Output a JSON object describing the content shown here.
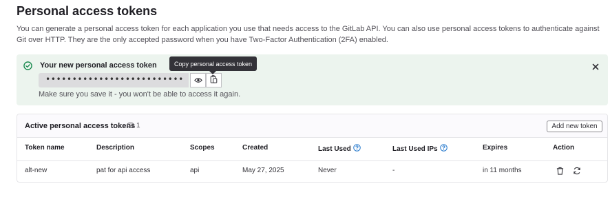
{
  "page": {
    "title": "Personal access tokens",
    "description": "You can generate a personal access token for each application you use that needs access to the GitLab API. You can also use personal access tokens to authenticate against Git over HTTP. They are the only accepted password when you have Two-Factor Authentication (2FA) enabled."
  },
  "alert": {
    "title": "Your new personal access token",
    "token_mask": "••••••••••••••••••••••••••",
    "note": "Make sure you save it - you won't be able to access it again.",
    "tooltip": "Copy personal access token"
  },
  "tokens_card": {
    "title": "Active personal access tokens",
    "count": "1",
    "add_button": "Add new token",
    "columns": [
      "Token name",
      "Description",
      "Scopes",
      "Created",
      "Last Used",
      "Last Used IPs",
      "Expires",
      "Action"
    ],
    "rows": [
      {
        "token_name": "alt-new",
        "description": "pat for api access",
        "scopes": "api",
        "created": "May 27, 2025",
        "last_used": "Never",
        "last_used_ips": "-",
        "expires": "in 11 months"
      }
    ]
  },
  "colors": {
    "alert_bg": "#ecf4ee",
    "success_green": "#108548",
    "help_blue": "#1f75cb",
    "tooltip_bg": "#333238"
  },
  "icons": [
    "check-circle-icon",
    "eye-icon",
    "copy-icon",
    "close-icon",
    "token-icon",
    "question-icon",
    "trash-icon",
    "rotate-icon"
  ]
}
